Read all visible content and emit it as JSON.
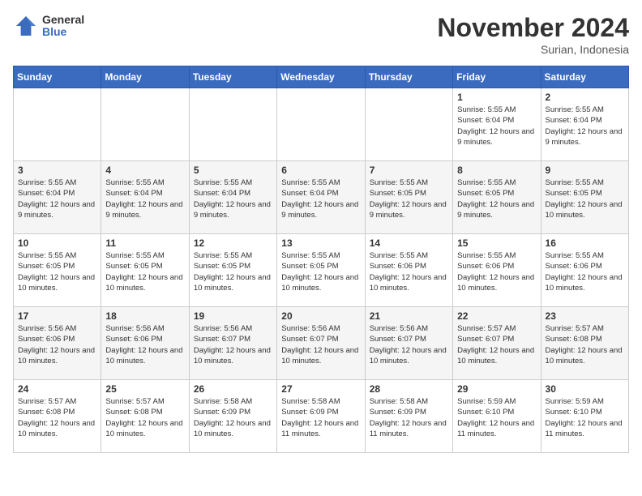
{
  "header": {
    "logo_general": "General",
    "logo_blue": "Blue",
    "month_title": "November 2024",
    "location": "Surian, Indonesia"
  },
  "days_of_week": [
    "Sunday",
    "Monday",
    "Tuesday",
    "Wednesday",
    "Thursday",
    "Friday",
    "Saturday"
  ],
  "weeks": [
    [
      {
        "day": "",
        "info": ""
      },
      {
        "day": "",
        "info": ""
      },
      {
        "day": "",
        "info": ""
      },
      {
        "day": "",
        "info": ""
      },
      {
        "day": "",
        "info": ""
      },
      {
        "day": "1",
        "info": "Sunrise: 5:55 AM\nSunset: 6:04 PM\nDaylight: 12 hours and 9 minutes."
      },
      {
        "day": "2",
        "info": "Sunrise: 5:55 AM\nSunset: 6:04 PM\nDaylight: 12 hours and 9 minutes."
      }
    ],
    [
      {
        "day": "3",
        "info": "Sunrise: 5:55 AM\nSunset: 6:04 PM\nDaylight: 12 hours and 9 minutes."
      },
      {
        "day": "4",
        "info": "Sunrise: 5:55 AM\nSunset: 6:04 PM\nDaylight: 12 hours and 9 minutes."
      },
      {
        "day": "5",
        "info": "Sunrise: 5:55 AM\nSunset: 6:04 PM\nDaylight: 12 hours and 9 minutes."
      },
      {
        "day": "6",
        "info": "Sunrise: 5:55 AM\nSunset: 6:04 PM\nDaylight: 12 hours and 9 minutes."
      },
      {
        "day": "7",
        "info": "Sunrise: 5:55 AM\nSunset: 6:05 PM\nDaylight: 12 hours and 9 minutes."
      },
      {
        "day": "8",
        "info": "Sunrise: 5:55 AM\nSunset: 6:05 PM\nDaylight: 12 hours and 9 minutes."
      },
      {
        "day": "9",
        "info": "Sunrise: 5:55 AM\nSunset: 6:05 PM\nDaylight: 12 hours and 10 minutes."
      }
    ],
    [
      {
        "day": "10",
        "info": "Sunrise: 5:55 AM\nSunset: 6:05 PM\nDaylight: 12 hours and 10 minutes."
      },
      {
        "day": "11",
        "info": "Sunrise: 5:55 AM\nSunset: 6:05 PM\nDaylight: 12 hours and 10 minutes."
      },
      {
        "day": "12",
        "info": "Sunrise: 5:55 AM\nSunset: 6:05 PM\nDaylight: 12 hours and 10 minutes."
      },
      {
        "day": "13",
        "info": "Sunrise: 5:55 AM\nSunset: 6:05 PM\nDaylight: 12 hours and 10 minutes."
      },
      {
        "day": "14",
        "info": "Sunrise: 5:55 AM\nSunset: 6:06 PM\nDaylight: 12 hours and 10 minutes."
      },
      {
        "day": "15",
        "info": "Sunrise: 5:55 AM\nSunset: 6:06 PM\nDaylight: 12 hours and 10 minutes."
      },
      {
        "day": "16",
        "info": "Sunrise: 5:55 AM\nSunset: 6:06 PM\nDaylight: 12 hours and 10 minutes."
      }
    ],
    [
      {
        "day": "17",
        "info": "Sunrise: 5:56 AM\nSunset: 6:06 PM\nDaylight: 12 hours and 10 minutes."
      },
      {
        "day": "18",
        "info": "Sunrise: 5:56 AM\nSunset: 6:06 PM\nDaylight: 12 hours and 10 minutes."
      },
      {
        "day": "19",
        "info": "Sunrise: 5:56 AM\nSunset: 6:07 PM\nDaylight: 12 hours and 10 minutes."
      },
      {
        "day": "20",
        "info": "Sunrise: 5:56 AM\nSunset: 6:07 PM\nDaylight: 12 hours and 10 minutes."
      },
      {
        "day": "21",
        "info": "Sunrise: 5:56 AM\nSunset: 6:07 PM\nDaylight: 12 hours and 10 minutes."
      },
      {
        "day": "22",
        "info": "Sunrise: 5:57 AM\nSunset: 6:07 PM\nDaylight: 12 hours and 10 minutes."
      },
      {
        "day": "23",
        "info": "Sunrise: 5:57 AM\nSunset: 6:08 PM\nDaylight: 12 hours and 10 minutes."
      }
    ],
    [
      {
        "day": "24",
        "info": "Sunrise: 5:57 AM\nSunset: 6:08 PM\nDaylight: 12 hours and 10 minutes."
      },
      {
        "day": "25",
        "info": "Sunrise: 5:57 AM\nSunset: 6:08 PM\nDaylight: 12 hours and 10 minutes."
      },
      {
        "day": "26",
        "info": "Sunrise: 5:58 AM\nSunset: 6:09 PM\nDaylight: 12 hours and 10 minutes."
      },
      {
        "day": "27",
        "info": "Sunrise: 5:58 AM\nSunset: 6:09 PM\nDaylight: 12 hours and 11 minutes."
      },
      {
        "day": "28",
        "info": "Sunrise: 5:58 AM\nSunset: 6:09 PM\nDaylight: 12 hours and 11 minutes."
      },
      {
        "day": "29",
        "info": "Sunrise: 5:59 AM\nSunset: 6:10 PM\nDaylight: 12 hours and 11 minutes."
      },
      {
        "day": "30",
        "info": "Sunrise: 5:59 AM\nSunset: 6:10 PM\nDaylight: 12 hours and 11 minutes."
      }
    ]
  ]
}
